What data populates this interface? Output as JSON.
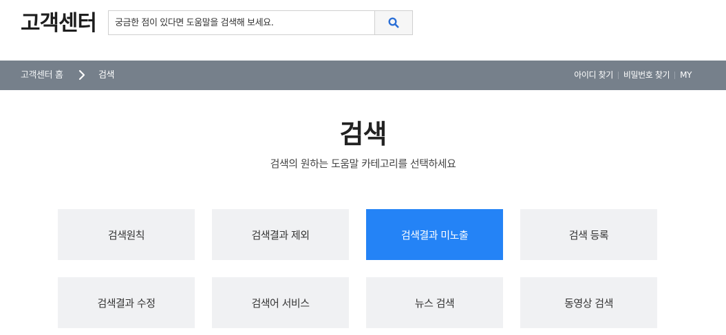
{
  "header": {
    "logo": "고객센터",
    "search": {
      "placeholder": "궁금한 점이 있다면 도움말을 검색해 보세요.",
      "value": "",
      "button_icon": "search-icon"
    }
  },
  "breadcrumb": {
    "home": "고객센터 홈",
    "separator_icon": "chevron-right-icon",
    "current": "검색"
  },
  "nav_links": [
    "아이디 찾기",
    "비밀번호 찾기",
    "MY"
  ],
  "main": {
    "title": "검색",
    "subtitle": "검색의 원하는 도움말 카테고리를 선택하세요"
  },
  "categories": [
    {
      "label": "검색원칙",
      "active": false
    },
    {
      "label": "검색결과 제외",
      "active": false
    },
    {
      "label": "검색결과 미노출",
      "active": true
    },
    {
      "label": "검색 등록",
      "active": false
    },
    {
      "label": "검색결과 수정",
      "active": false
    },
    {
      "label": "검색어 서비스",
      "active": false
    },
    {
      "label": "뉴스 검색",
      "active": false
    },
    {
      "label": "동영상 검색",
      "active": false
    }
  ],
  "colors": {
    "accent": "#2483f6",
    "navbar": "#76808b",
    "tile": "#f0f1f3",
    "search_icon": "#2b6fd6"
  }
}
